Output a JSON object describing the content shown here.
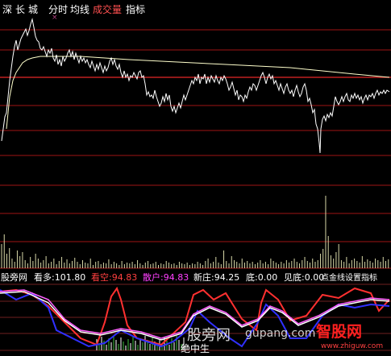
{
  "toolbar": {
    "items": [
      {
        "label": "深",
        "color": "#ffffff"
      },
      {
        "label": "长",
        "color": "#ffffff"
      },
      {
        "label": "城",
        "color": "#ffffff"
      },
      {
        "label": "分时",
        "color": "#ffffff"
      },
      {
        "label": "均线",
        "color": "#ffffff"
      },
      {
        "label": "成交量",
        "color": "#ff5050"
      },
      {
        "label": "指标",
        "color": "#ffffff"
      }
    ],
    "cross_marker": "×"
  },
  "indicator_bar": {
    "name": "股旁网",
    "fields": [
      {
        "label": "看多:101.80",
        "color": "#ffffff"
      },
      {
        "label": "看空:94.83",
        "color": "#ff4040"
      },
      {
        "label": "散户:94.83",
        "color": "#ff40ff"
      },
      {
        "label": "新庄:94.25",
        "color": "#ffffff"
      },
      {
        "label": "底:0.00",
        "color": "#ffffff"
      },
      {
        "label": "见底:0.00",
        "color": "#ffffff"
      },
      {
        "label": "点金线设置指标",
        "color": "#ffffff"
      }
    ]
  },
  "bottom_label": "绝中生",
  "watermarks": {
    "main": "股旁网",
    "url": "gupang.com",
    "brand": "智股网",
    "brand_url": "www.zhiguw.com"
  },
  "colors": {
    "background": "#000000",
    "grid": "#a01414",
    "price_line": "#ffffff",
    "avg_line": "#ffffcc",
    "volume": "#d8d8a8",
    "kd_white": "#ffffff",
    "kd_red": "#ff3030",
    "kd_blue": "#3030ff",
    "kd_magenta": "#ff60ff"
  }
}
